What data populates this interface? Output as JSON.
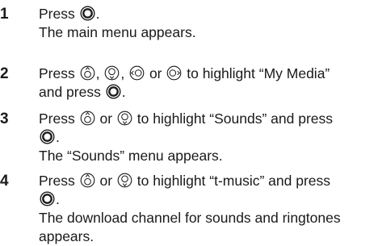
{
  "steps": [
    {
      "number": "1",
      "segments": [
        {
          "t": "text",
          "v": "Press "
        },
        {
          "t": "icon",
          "icon": "center-key-icon"
        },
        {
          "t": "text",
          "v": "."
        }
      ],
      "result": "The main menu appears."
    },
    {
      "number": "2",
      "line1": [
        {
          "t": "text",
          "v": "Press "
        },
        {
          "t": "icon",
          "icon": "nav-up-key-icon"
        },
        {
          "t": "text",
          "v": ", "
        },
        {
          "t": "icon",
          "icon": "nav-down-key-icon"
        },
        {
          "t": "text",
          "v": ", "
        },
        {
          "t": "icon",
          "icon": "nav-left-key-icon"
        },
        {
          "t": "text",
          "v": " or "
        },
        {
          "t": "icon",
          "icon": "nav-right-key-icon"
        },
        {
          "t": "text",
          "v": " to highlight “My Media”"
        }
      ],
      "line2": [
        {
          "t": "text",
          "v": "and press "
        },
        {
          "t": "icon",
          "icon": "center-key-icon"
        },
        {
          "t": "text",
          "v": "."
        }
      ]
    },
    {
      "number": "3",
      "line1": [
        {
          "t": "text",
          "v": "Press "
        },
        {
          "t": "icon",
          "icon": "nav-up-key-icon"
        },
        {
          "t": "text",
          "v": " or "
        },
        {
          "t": "icon",
          "icon": "nav-down-key-icon"
        },
        {
          "t": "text",
          "v": " to highlight “Sounds” and press"
        }
      ],
      "line2": [
        {
          "t": "icon",
          "icon": "center-key-icon"
        },
        {
          "t": "text",
          "v": "."
        }
      ],
      "result": "The “Sounds” menu appears."
    },
    {
      "number": "4",
      "line1": [
        {
          "t": "text",
          "v": "Press "
        },
        {
          "t": "icon",
          "icon": "nav-up-key-icon"
        },
        {
          "t": "text",
          "v": " or "
        },
        {
          "t": "icon",
          "icon": "nav-down-key-icon"
        },
        {
          "t": "text",
          "v": " to highlight “t-music” and press"
        }
      ],
      "line2": [
        {
          "t": "icon",
          "icon": "center-key-icon"
        },
        {
          "t": "text",
          "v": "."
        }
      ],
      "result_lines": [
        "The download channel for sounds and ringtones",
        "appears."
      ]
    }
  ]
}
